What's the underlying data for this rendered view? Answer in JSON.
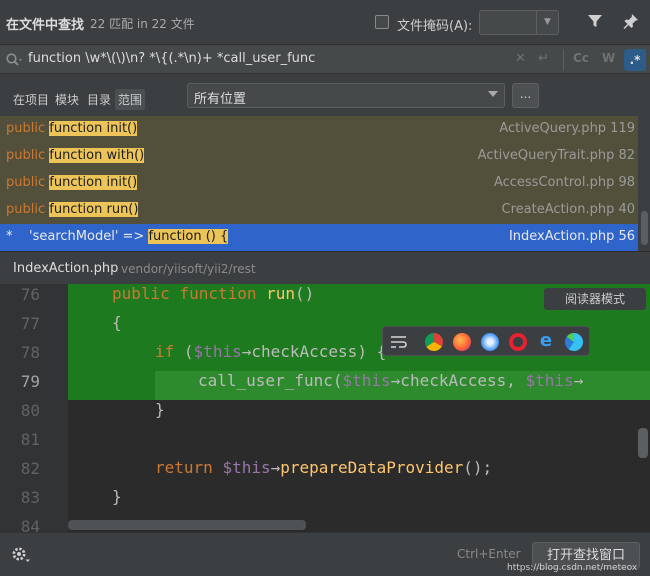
{
  "header": {
    "title": "在文件中查找",
    "count": "22 匹配 in 22 文件",
    "file_mask_label": "文件掩码(A):",
    "file_mask_value": ""
  },
  "search": {
    "query": "function \\w*\\(\\)\\n? *\\{(.*\\n)+ *call_user_func",
    "match_case": "Cc",
    "words": "W",
    "regex": ".*"
  },
  "scope": {
    "tabs": [
      "在项目",
      "模块",
      "目录",
      "范围"
    ],
    "active_tab": "范围",
    "location": "所有位置",
    "more": "..."
  },
  "results": [
    {
      "pre": "public ",
      "match": "function init()",
      "post": "",
      "file": "ActiveQuery.php 119"
    },
    {
      "pre": "public ",
      "match": "function with()",
      "post": "",
      "file": "ActiveQueryTrait.php 82"
    },
    {
      "pre": "public ",
      "match": "function init()",
      "post": "",
      "file": "AccessControl.php 98"
    },
    {
      "pre": "public ",
      "match": "function run()",
      "post": "",
      "file": "CreateAction.php 40"
    },
    {
      "pre": "'searchModel' => ",
      "match": "function () {",
      "post": "",
      "file": "IndexAction.php 56",
      "star": "*"
    }
  ],
  "path": {
    "file": "IndexAction.php",
    "dir": "vendor/yiisoft/yii2/rest"
  },
  "editor": {
    "line_numbers": [
      "76",
      "77",
      "78",
      "79",
      "80",
      "81",
      "82",
      "83",
      "84"
    ],
    "reader_mode": "阅读器模式",
    "lines": {
      "l76_kw": "public function ",
      "l76_fn": "run",
      "l76_rest": "()",
      "l77": "{",
      "l78_kw": "if ",
      "l78_a": "(",
      "l78_var": "$this",
      "l78_b": "→checkAccess",
      "l78_c": ") {",
      "l79_fn": "call_user_func",
      "l79_a": "(",
      "l79_var": "$this",
      "l79_b": "→checkAccess, ",
      "l79_var2": "$this",
      "l79_c": "→",
      "l80": "}",
      "l82_kw": "return ",
      "l82_var": "$this",
      "l82_a": "→",
      "l82_m": "prepareDataProvider",
      "l82_b": "();",
      "l83": "}"
    }
  },
  "footer": {
    "shortcut": "Ctrl+Enter",
    "open_button": "打开查找窗口",
    "watermark": "https://blog.csdn.net/meteox"
  },
  "colors": {
    "keyword": "#cc7832",
    "highlight": "#ecc458",
    "selected_row": "#2f65ca",
    "match_band": "#1e7a1e"
  }
}
